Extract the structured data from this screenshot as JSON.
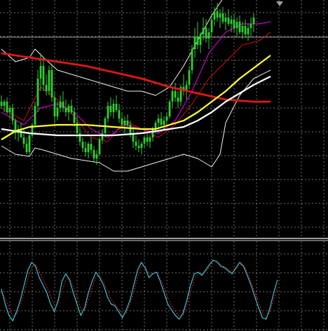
{
  "colors": {
    "background": "#000000",
    "grid": "#c8c8c8",
    "candle": "#32cd32",
    "ma_red": "#e01818",
    "ma_white": "#ffffff",
    "ma_yellow": "#ffff33",
    "bollinger": "#f0f0f0",
    "magenta": "#c800c8",
    "thin_red": "#d01010",
    "osc_main": "#40c0d0",
    "osc_signal": "#e01818",
    "separator": "#d0d0d0"
  },
  "chart_data": [
    {
      "type": "candlestick",
      "grid": true,
      "ylim": [
        0,
        1
      ],
      "n_bars": 100,
      "candles": [
        [
          0.55,
          0.58,
          0.52,
          0.53
        ],
        [
          0.53,
          0.56,
          0.5,
          0.55
        ],
        [
          0.55,
          0.57,
          0.49,
          0.5
        ],
        [
          0.5,
          0.53,
          0.47,
          0.52
        ],
        [
          0.52,
          0.54,
          0.44,
          0.46
        ],
        [
          0.46,
          0.47,
          0.37,
          0.4
        ],
        [
          0.4,
          0.44,
          0.36,
          0.42
        ],
        [
          0.42,
          0.45,
          0.38,
          0.38
        ],
        [
          0.38,
          0.42,
          0.33,
          0.35
        ],
        [
          0.35,
          0.38,
          0.3,
          0.31
        ],
        [
          0.31,
          0.4,
          0.3,
          0.39
        ],
        [
          0.39,
          0.45,
          0.38,
          0.44
        ],
        [
          0.44,
          0.55,
          0.43,
          0.53
        ],
        [
          0.53,
          0.7,
          0.5,
          0.66
        ],
        [
          0.66,
          0.78,
          0.6,
          0.72
        ],
        [
          0.72,
          0.76,
          0.6,
          0.63
        ],
        [
          0.63,
          0.68,
          0.58,
          0.6
        ],
        [
          0.6,
          0.72,
          0.58,
          0.7
        ],
        [
          0.7,
          0.73,
          0.55,
          0.57
        ],
        [
          0.57,
          0.6,
          0.45,
          0.48
        ],
        [
          0.48,
          0.55,
          0.46,
          0.52
        ],
        [
          0.52,
          0.58,
          0.5,
          0.55
        ],
        [
          0.55,
          0.6,
          0.5,
          0.52
        ],
        [
          0.52,
          0.56,
          0.48,
          0.5
        ],
        [
          0.5,
          0.54,
          0.46,
          0.53
        ],
        [
          0.53,
          0.56,
          0.49,
          0.5
        ],
        [
          0.5,
          0.52,
          0.43,
          0.45
        ],
        [
          0.45,
          0.48,
          0.38,
          0.4
        ],
        [
          0.4,
          0.43,
          0.34,
          0.36
        ],
        [
          0.36,
          0.38,
          0.31,
          0.33
        ],
        [
          0.33,
          0.36,
          0.29,
          0.31
        ],
        [
          0.31,
          0.36,
          0.28,
          0.35
        ],
        [
          0.35,
          0.38,
          0.3,
          0.32
        ],
        [
          0.32,
          0.34,
          0.26,
          0.28
        ],
        [
          0.28,
          0.32,
          0.25,
          0.3
        ],
        [
          0.3,
          0.38,
          0.29,
          0.37
        ],
        [
          0.37,
          0.42,
          0.35,
          0.4
        ],
        [
          0.4,
          0.48,
          0.38,
          0.47
        ],
        [
          0.47,
          0.55,
          0.45,
          0.53
        ],
        [
          0.53,
          0.57,
          0.48,
          0.5
        ],
        [
          0.5,
          0.56,
          0.47,
          0.54
        ],
        [
          0.54,
          0.58,
          0.5,
          0.51
        ],
        [
          0.51,
          0.54,
          0.45,
          0.47
        ],
        [
          0.47,
          0.5,
          0.42,
          0.44
        ],
        [
          0.44,
          0.48,
          0.4,
          0.46
        ],
        [
          0.46,
          0.49,
          0.43,
          0.44
        ],
        [
          0.44,
          0.46,
          0.38,
          0.4
        ],
        [
          0.4,
          0.43,
          0.33,
          0.36
        ],
        [
          0.36,
          0.39,
          0.32,
          0.34
        ],
        [
          0.34,
          0.37,
          0.31,
          0.33
        ],
        [
          0.33,
          0.36,
          0.3,
          0.35
        ],
        [
          0.35,
          0.39,
          0.33,
          0.38
        ],
        [
          0.38,
          0.4,
          0.34,
          0.36
        ],
        [
          0.36,
          0.39,
          0.33,
          0.38
        ],
        [
          0.38,
          0.43,
          0.36,
          0.42
        ],
        [
          0.42,
          0.46,
          0.4,
          0.45
        ],
        [
          0.45,
          0.49,
          0.42,
          0.47
        ],
        [
          0.47,
          0.5,
          0.43,
          0.44
        ],
        [
          0.44,
          0.48,
          0.42,
          0.46
        ],
        [
          0.46,
          0.5,
          0.44,
          0.48
        ],
        [
          0.48,
          0.56,
          0.47,
          0.55
        ],
        [
          0.55,
          0.62,
          0.52,
          0.6
        ],
        [
          0.6,
          0.64,
          0.55,
          0.57
        ],
        [
          0.57,
          0.6,
          0.52,
          0.55
        ],
        [
          0.55,
          0.63,
          0.53,
          0.62
        ],
        [
          0.62,
          0.68,
          0.58,
          0.6
        ],
        [
          0.6,
          0.65,
          0.56,
          0.63
        ],
        [
          0.63,
          0.72,
          0.61,
          0.7
        ],
        [
          0.7,
          0.82,
          0.68,
          0.8
        ],
        [
          0.8,
          0.9,
          0.76,
          0.86
        ],
        [
          0.86,
          0.93,
          0.8,
          0.82
        ],
        [
          0.82,
          0.88,
          0.78,
          0.87
        ],
        [
          0.87,
          0.95,
          0.84,
          0.9
        ],
        [
          0.9,
          0.94,
          0.83,
          0.85
        ],
        [
          0.85,
          0.9,
          0.8,
          0.88
        ],
        [
          0.88,
          0.96,
          0.86,
          0.94
        ],
        [
          0.94,
          1.0,
          0.91,
          0.98
        ],
        [
          0.98,
          1.02,
          0.93,
          0.95
        ],
        [
          0.95,
          0.99,
          0.9,
          0.97
        ],
        [
          0.97,
          1.0,
          0.92,
          0.93
        ],
        [
          0.93,
          0.97,
          0.89,
          0.95
        ],
        [
          0.95,
          0.99,
          0.91,
          0.92
        ],
        [
          0.92,
          0.96,
          0.88,
          0.94
        ],
        [
          0.94,
          0.97,
          0.88,
          0.9
        ],
        [
          0.9,
          0.95,
          0.86,
          0.93
        ],
        [
          0.93,
          0.96,
          0.87,
          0.88
        ],
        [
          0.88,
          0.93,
          0.85,
          0.91
        ],
        [
          0.91,
          0.94,
          0.86,
          0.87
        ],
        [
          0.87,
          0.92,
          0.84,
          0.9
        ],
        [
          0.9,
          0.95,
          0.86,
          0.92
        ],
        [
          0.92,
          0.97,
          0.88,
          0.95
        ]
      ],
      "lines": {
        "ma_red": [
          [
            0,
            0.78
          ],
          [
            10,
            0.76
          ],
          [
            20,
            0.74
          ],
          [
            30,
            0.72
          ],
          [
            40,
            0.69
          ],
          [
            50,
            0.66
          ],
          [
            60,
            0.62
          ],
          [
            70,
            0.59
          ],
          [
            80,
            0.56
          ],
          [
            90,
            0.55
          ],
          [
            96,
            0.55
          ]
        ],
        "ma_white": [
          [
            0,
            0.42
          ],
          [
            10,
            0.4
          ],
          [
            20,
            0.39
          ],
          [
            30,
            0.39
          ],
          [
            40,
            0.39
          ],
          [
            50,
            0.4
          ],
          [
            60,
            0.42
          ],
          [
            65,
            0.43
          ],
          [
            70,
            0.46
          ],
          [
            75,
            0.5
          ],
          [
            80,
            0.55
          ],
          [
            85,
            0.59
          ],
          [
            90,
            0.63
          ],
          [
            96,
            0.67
          ]
        ],
        "ma_yellow": [
          [
            0,
            0.37
          ],
          [
            5,
            0.41
          ],
          [
            10,
            0.43
          ],
          [
            20,
            0.44
          ],
          [
            30,
            0.44
          ],
          [
            40,
            0.43
          ],
          [
            50,
            0.42
          ],
          [
            55,
            0.42
          ],
          [
            60,
            0.44
          ],
          [
            65,
            0.46
          ],
          [
            70,
            0.5
          ],
          [
            75,
            0.55
          ],
          [
            80,
            0.6
          ],
          [
            85,
            0.66
          ],
          [
            90,
            0.71
          ],
          [
            96,
            0.77
          ]
        ],
        "boll_upper": [
          [
            0,
            0.8
          ],
          [
            5,
            0.74
          ],
          [
            10,
            0.76
          ],
          [
            12,
            0.8
          ],
          [
            15,
            0.76
          ],
          [
            20,
            0.7
          ],
          [
            25,
            0.68
          ],
          [
            30,
            0.66
          ],
          [
            35,
            0.64
          ],
          [
            40,
            0.62
          ],
          [
            45,
            0.6
          ],
          [
            50,
            0.6
          ],
          [
            55,
            0.58
          ],
          [
            60,
            0.62
          ],
          [
            65,
            0.72
          ],
          [
            70,
            0.84
          ],
          [
            75,
            0.96
          ],
          [
            80,
            1.06
          ],
          [
            85,
            1.1
          ],
          [
            90,
            1.08
          ],
          [
            96,
            1.07
          ]
        ],
        "boll_lower": [
          [
            0,
            0.34
          ],
          [
            5,
            0.3
          ],
          [
            10,
            0.29
          ],
          [
            12,
            0.33
          ],
          [
            15,
            0.32
          ],
          [
            20,
            0.3
          ],
          [
            25,
            0.28
          ],
          [
            30,
            0.27
          ],
          [
            35,
            0.26
          ],
          [
            40,
            0.22
          ],
          [
            45,
            0.22
          ],
          [
            50,
            0.24
          ],
          [
            55,
            0.26
          ],
          [
            60,
            0.28
          ],
          [
            65,
            0.3
          ],
          [
            70,
            0.28
          ],
          [
            75,
            0.24
          ],
          [
            78,
            0.3
          ],
          [
            80,
            0.45
          ],
          [
            85,
            0.58
          ],
          [
            90,
            0.66
          ],
          [
            96,
            0.7
          ]
        ],
        "magenta": [
          [
            0,
            0.5
          ],
          [
            8,
            0.44
          ],
          [
            14,
            0.52
          ],
          [
            20,
            0.54
          ],
          [
            26,
            0.5
          ],
          [
            32,
            0.42
          ],
          [
            38,
            0.38
          ],
          [
            44,
            0.44
          ],
          [
            50,
            0.42
          ],
          [
            56,
            0.4
          ],
          [
            62,
            0.46
          ],
          [
            68,
            0.6
          ],
          [
            74,
            0.78
          ],
          [
            80,
            0.88
          ],
          [
            86,
            0.92
          ],
          [
            92,
            0.92
          ],
          [
            96,
            0.93
          ]
        ],
        "thin_red": [
          [
            0,
            0.52
          ],
          [
            8,
            0.46
          ],
          [
            14,
            0.62
          ],
          [
            20,
            0.56
          ],
          [
            26,
            0.48
          ],
          [
            32,
            0.38
          ],
          [
            38,
            0.36
          ],
          [
            44,
            0.46
          ],
          [
            50,
            0.42
          ],
          [
            56,
            0.38
          ],
          [
            62,
            0.44
          ],
          [
            68,
            0.54
          ],
          [
            74,
            0.66
          ],
          [
            80,
            0.74
          ],
          [
            86,
            0.82
          ],
          [
            92,
            0.84
          ],
          [
            96,
            0.88
          ]
        ]
      }
    },
    {
      "type": "line",
      "grid": true,
      "ylim": [
        0,
        100
      ],
      "series": [
        {
          "values": [
            50,
            30,
            15,
            8,
            20,
            35,
            55,
            75,
            85,
            80,
            65,
            55,
            45,
            30,
            20,
            35,
            60,
            70,
            62,
            45,
            30,
            15,
            25,
            45,
            60,
            72,
            65,
            55,
            40,
            30,
            28,
            20,
            12,
            22,
            35,
            55,
            75,
            85,
            78,
            65,
            70,
            72,
            60,
            45,
            30,
            22,
            15,
            10,
            18,
            35,
            55,
            70,
            72,
            68,
            75,
            82,
            88,
            86,
            80,
            78,
            74,
            70,
            78,
            85,
            80,
            68,
            55,
            40,
            25,
            12,
            10,
            25,
            45,
            62
          ]
        },
        {
          "values": [
            45,
            38,
            25,
            14,
            16,
            28,
            45,
            64,
            78,
            82,
            74,
            62,
            52,
            40,
            28,
            30,
            48,
            62,
            64,
            54,
            40,
            24,
            22,
            36,
            52,
            66,
            68,
            60,
            48,
            36,
            30,
            24,
            16,
            18,
            30,
            46,
            66,
            80,
            80,
            70,
            70,
            72,
            64,
            52,
            38,
            28,
            20,
            14,
            15,
            28,
            46,
            62,
            70,
            70,
            73,
            79,
            85,
            86,
            82,
            79,
            76,
            72,
            76,
            82,
            81,
            72,
            60,
            46,
            32,
            18,
            12,
            20,
            36,
            52
          ]
        }
      ]
    }
  ]
}
